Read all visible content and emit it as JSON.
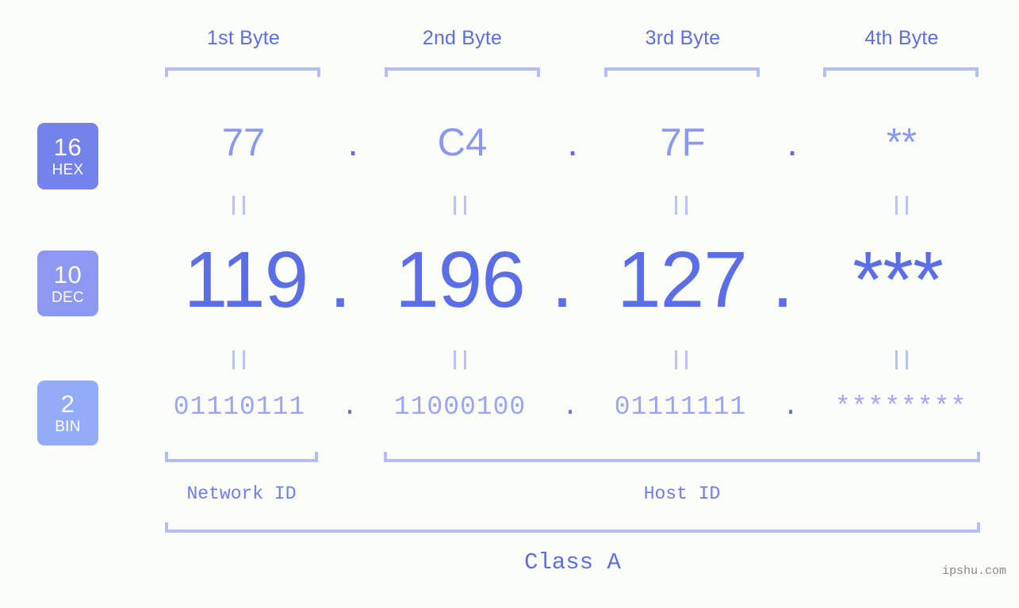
{
  "background_color": "#fbfdf8",
  "accent_color": "#5b6ee8",
  "accent_light_color": "#8b98f3",
  "bracket_color": "#b3bdfb",
  "byte_headers": [
    {
      "label": "1st Byte"
    },
    {
      "label": "2nd Byte"
    },
    {
      "label": "3rd Byte"
    },
    {
      "label": "4th Byte"
    }
  ],
  "bases": [
    {
      "number": "16",
      "name": "HEX",
      "color": "#7482ec"
    },
    {
      "number": "10",
      "name": "DEC",
      "color": "#8c98f2"
    },
    {
      "number": "2",
      "name": "BIN",
      "color": "#94abf7"
    }
  ],
  "rows": {
    "hex": {
      "values": [
        "77",
        "C4",
        "7F",
        "**"
      ],
      "separator": "."
    },
    "dec": {
      "values": [
        "119",
        "196",
        "127",
        "***"
      ],
      "separator": "."
    },
    "bin": {
      "values": [
        "01110111",
        "11000100",
        "01111111",
        "********"
      ],
      "separator": "."
    }
  },
  "equals_marks": [
    {
      "symbol": "||"
    },
    {
      "symbol": "||"
    },
    {
      "symbol": "||"
    },
    {
      "symbol": "||"
    },
    {
      "symbol": "||"
    },
    {
      "symbol": "||"
    },
    {
      "symbol": "||"
    },
    {
      "symbol": "||"
    }
  ],
  "id_sections": [
    {
      "label": "Network ID"
    },
    {
      "label": "Host ID"
    }
  ],
  "class_label": "Class A",
  "watermark": "ipshu.com",
  "ip_address": {
    "hex": "77.C4.7F.**",
    "dec": "119.196.127.***",
    "bin": "01110111.11000100.01111111.********"
  }
}
